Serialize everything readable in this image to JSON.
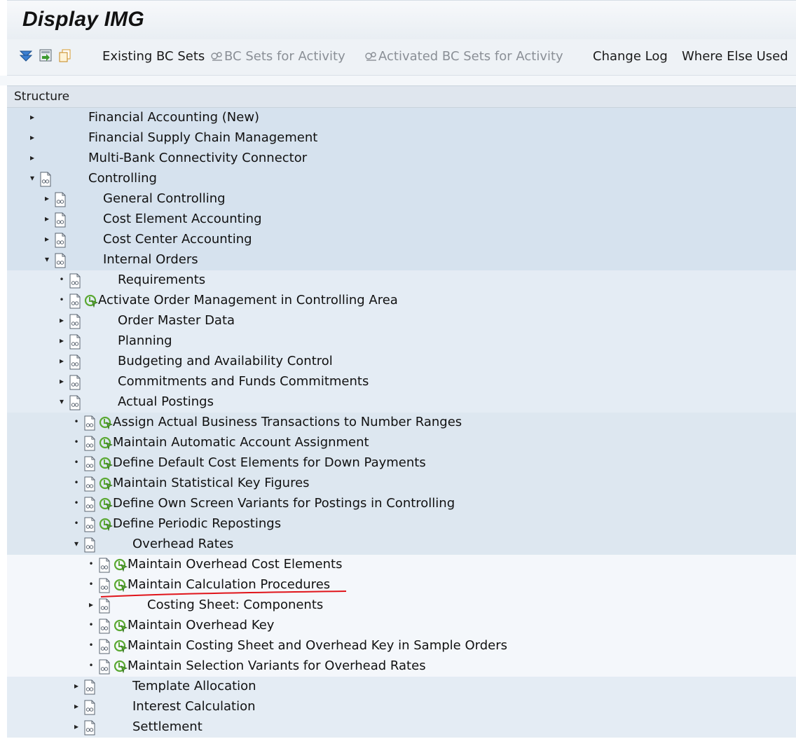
{
  "window": {
    "title": "Display IMG"
  },
  "toolbar": {
    "buttons": [
      {
        "label": "Existing BC Sets",
        "disabled": false,
        "glyph": ""
      },
      {
        "label": "BC Sets for Activity",
        "disabled": true,
        "glyph": "bc-set-icon"
      },
      {
        "label": "Activated BC Sets for Activity",
        "disabled": true,
        "glyph": "bc-set-icon"
      },
      {
        "label": "Change Log",
        "disabled": false,
        "glyph": ""
      },
      {
        "label": "Where Else Used",
        "disabled": false,
        "glyph": ""
      }
    ],
    "icons": [
      "expand-all-icon",
      "import-icon",
      "copy-icon"
    ]
  },
  "structure": {
    "header": "Structure"
  },
  "tree": [
    {
      "label": "Financial Accounting (New)",
      "level": 0,
      "toggle": "collapsed",
      "doc": false,
      "exec": false
    },
    {
      "label": "Financial Supply Chain Management",
      "level": 0,
      "toggle": "collapsed",
      "doc": false,
      "exec": false
    },
    {
      "label": "Multi-Bank Connectivity Connector",
      "level": 0,
      "toggle": "collapsed",
      "doc": false,
      "exec": false
    },
    {
      "label": "Controlling",
      "level": 0,
      "toggle": "expanded",
      "doc": true,
      "exec": false
    },
    {
      "label": "General Controlling",
      "level": 1,
      "toggle": "collapsed",
      "doc": true,
      "exec": false
    },
    {
      "label": "Cost Element Accounting",
      "level": 1,
      "toggle": "collapsed",
      "doc": true,
      "exec": false
    },
    {
      "label": "Cost Center Accounting",
      "level": 1,
      "toggle": "collapsed",
      "doc": true,
      "exec": false
    },
    {
      "label": "Internal Orders",
      "level": 1,
      "toggle": "expanded",
      "doc": true,
      "exec": false
    },
    {
      "label": "Requirements",
      "level": 2,
      "toggle": "leaf",
      "doc": true,
      "exec": false
    },
    {
      "label": "Activate Order Management in Controlling Area",
      "level": 2,
      "toggle": "leaf",
      "doc": true,
      "exec": true
    },
    {
      "label": "Order Master Data",
      "level": 2,
      "toggle": "collapsed",
      "doc": true,
      "exec": false
    },
    {
      "label": "Planning",
      "level": 2,
      "toggle": "collapsed",
      "doc": true,
      "exec": false
    },
    {
      "label": "Budgeting and Availability Control",
      "level": 2,
      "toggle": "collapsed",
      "doc": true,
      "exec": false
    },
    {
      "label": "Commitments and Funds Commitments",
      "level": 2,
      "toggle": "collapsed",
      "doc": true,
      "exec": false
    },
    {
      "label": "Actual Postings",
      "level": 2,
      "toggle": "expanded",
      "doc": true,
      "exec": false
    },
    {
      "label": "Assign Actual Business Transactions to Number Ranges",
      "level": 3,
      "toggle": "leaf",
      "doc": true,
      "exec": true
    },
    {
      "label": "Maintain Automatic Account Assignment",
      "level": 3,
      "toggle": "leaf",
      "doc": true,
      "exec": true
    },
    {
      "label": "Define Default Cost Elements for Down Payments",
      "level": 3,
      "toggle": "leaf",
      "doc": true,
      "exec": true
    },
    {
      "label": "Maintain Statistical Key Figures",
      "level": 3,
      "toggle": "leaf",
      "doc": true,
      "exec": true
    },
    {
      "label": "Define Own Screen Variants for Postings in Controlling",
      "level": 3,
      "toggle": "leaf",
      "doc": true,
      "exec": true
    },
    {
      "label": "Define Periodic Repostings",
      "level": 3,
      "toggle": "leaf",
      "doc": true,
      "exec": true
    },
    {
      "label": "Overhead Rates",
      "level": 3,
      "toggle": "expanded",
      "doc": true,
      "exec": false
    },
    {
      "label": "Maintain Overhead Cost Elements",
      "level": 4,
      "toggle": "leaf",
      "doc": true,
      "exec": true
    },
    {
      "label": "Maintain Calculation Procedures",
      "level": 4,
      "toggle": "leaf",
      "doc": true,
      "exec": true,
      "highlighted": true
    },
    {
      "label": "Costing Sheet: Components",
      "level": 4,
      "toggle": "collapsed",
      "doc": true,
      "exec": false
    },
    {
      "label": "Maintain Overhead Key",
      "level": 4,
      "toggle": "leaf",
      "doc": true,
      "exec": true
    },
    {
      "label": "Maintain Costing Sheet and Overhead Key in Sample Orders",
      "level": 4,
      "toggle": "leaf",
      "doc": true,
      "exec": true
    },
    {
      "label": "Maintain Selection Variants for Overhead Rates",
      "level": 4,
      "toggle": "leaf",
      "doc": true,
      "exec": true
    },
    {
      "label": "Template Allocation",
      "level": 3,
      "toggle": "collapsed",
      "doc": true,
      "exec": false
    },
    {
      "label": "Interest Calculation",
      "level": 3,
      "toggle": "collapsed",
      "doc": true,
      "exec": false
    },
    {
      "label": "Settlement",
      "level": 3,
      "toggle": "collapsed",
      "doc": true,
      "exec": false
    }
  ],
  "colors": {
    "execute_green": "#5aa832",
    "annotation_red": "#e0151b",
    "band_level1": "#d6e2ee",
    "band_level2": "#e4ecf4",
    "band_level3": "#f4f7fb"
  }
}
